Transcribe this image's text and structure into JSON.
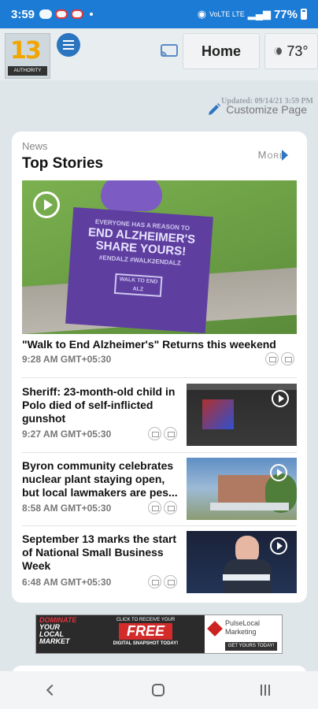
{
  "status_bar": {
    "time": "3:59",
    "network_label": "VoLTE LTE",
    "battery": "77%"
  },
  "header": {
    "logo_text": "13",
    "logo_sub": "AUTHORITY",
    "home_label": "Home",
    "temperature": "73°",
    "updated": "Updated: 09/14/21 3:59 PM"
  },
  "customize_label": "Customize Page",
  "news": {
    "section_label": "News",
    "title": "Top Stories",
    "more_label": "More",
    "hero": {
      "headline": "\"Walk to End Alzheimer's\" Returns this weekend",
      "time": "9:28 AM GMT+05:30",
      "sign_line1": "EVERYONE HAS A REASON TO",
      "sign_line2": "END ALZHEIMER'S SHARE YOURS!",
      "sign_line3": "#ENDALZ #WALK2ENDALZ",
      "sign_walk": "WALK TO END ALZ"
    },
    "stories": [
      {
        "headline": "Sheriff: 23-month-old child in Polo died of self-inflicted gunshot",
        "time": "9:27 AM GMT+05:30"
      },
      {
        "headline": "Byron community celebrates nuclear plant staying open, but local lawmakers are pes...",
        "time": "8:58 AM GMT+05:30"
      },
      {
        "headline": "September 13 marks the start of National Small Business Week",
        "time": "6:48 AM GMT+05:30"
      }
    ]
  },
  "ad": {
    "left_line1": "DOMINATE",
    "left_line2": "YOUR",
    "left_line3": "LOCAL",
    "left_line4": "MARKET",
    "mid_top": "CLICK TO RECEIVE YOUR",
    "mid_free": "FREE",
    "mid_bottom": "DIGITAL SNAPSHOT TODAY!",
    "brand": "PulseLocal Marketing",
    "cta": "GET YOURS TODAY!"
  },
  "colors": {
    "status_bar": "#1c7bd4",
    "accent": "#2e75c4"
  }
}
